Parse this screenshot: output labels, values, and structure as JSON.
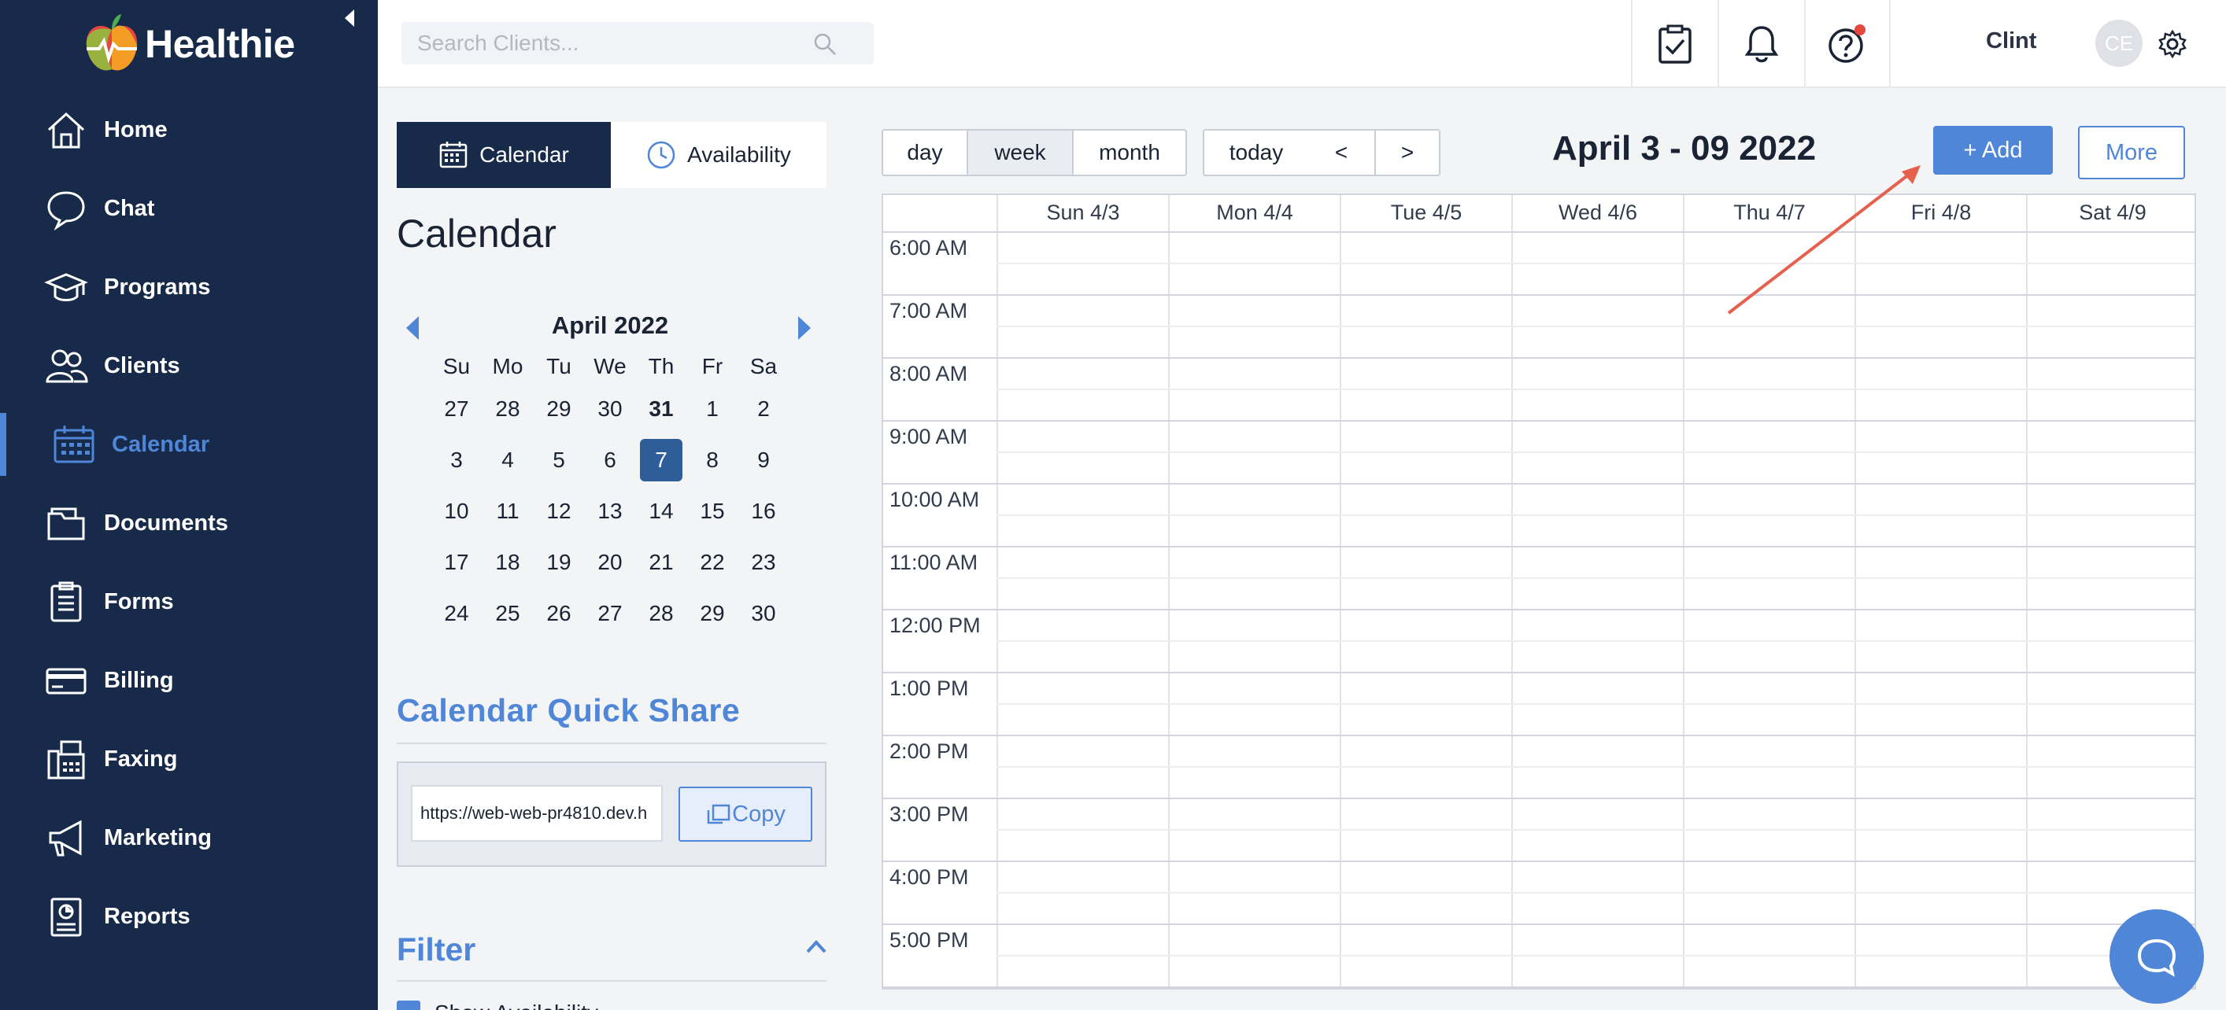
{
  "app": {
    "name": "Healthie"
  },
  "sidebar": {
    "items": [
      {
        "label": "Home",
        "icon": "home-icon"
      },
      {
        "label": "Chat",
        "icon": "chat-icon"
      },
      {
        "label": "Programs",
        "icon": "graduation-cap-icon"
      },
      {
        "label": "Clients",
        "icon": "users-icon"
      },
      {
        "label": "Calendar",
        "icon": "calendar-icon",
        "active": true
      },
      {
        "label": "Documents",
        "icon": "folder-icon"
      },
      {
        "label": "Forms",
        "icon": "clipboard-icon"
      },
      {
        "label": "Billing",
        "icon": "credit-card-icon"
      },
      {
        "label": "Faxing",
        "icon": "fax-icon"
      },
      {
        "label": "Marketing",
        "icon": "megaphone-icon"
      },
      {
        "label": "Reports",
        "icon": "report-icon"
      }
    ]
  },
  "topbar": {
    "search_placeholder": "Search Clients...",
    "user_name": "Clint",
    "avatar_initials": "CE"
  },
  "tabs": {
    "calendar": "Calendar",
    "availability": "Availability"
  },
  "panel_title": "Calendar",
  "mini_calendar": {
    "month_label": "April 2022",
    "weekdays": [
      "Su",
      "Mo",
      "Tu",
      "We",
      "Th",
      "Fr",
      "Sa"
    ],
    "weeks": [
      [
        "27",
        "28",
        "29",
        "30",
        "31",
        "1",
        "2"
      ],
      [
        "3",
        "4",
        "5",
        "6",
        "7",
        "8",
        "9"
      ],
      [
        "10",
        "11",
        "12",
        "13",
        "14",
        "15",
        "16"
      ],
      [
        "17",
        "18",
        "19",
        "20",
        "21",
        "22",
        "23"
      ],
      [
        "24",
        "25",
        "26",
        "27",
        "28",
        "29",
        "30"
      ]
    ],
    "selected": "7"
  },
  "quick_share": {
    "title": "Calendar Quick Share",
    "url": "https://web-web-pr4810.dev.h",
    "copy_label": "Copy"
  },
  "filter": {
    "title": "Filter",
    "checkbox_label": "Show Availability"
  },
  "view_buttons": {
    "day": "day",
    "week": "week",
    "month": "month",
    "today": "today",
    "prev": "<",
    "next": ">"
  },
  "range_title": "April 3 - 09 2022",
  "actions": {
    "add": "+ Add",
    "more": "More"
  },
  "week": {
    "days": [
      "Sun 4/3",
      "Mon 4/4",
      "Tue 4/5",
      "Wed 4/6",
      "Thu 4/7",
      "Fri 4/8",
      "Sat 4/9"
    ],
    "times": [
      "6:00 AM",
      "7:00 AM",
      "8:00 AM",
      "9:00 AM",
      "10:00 AM",
      "11:00 AM",
      "12:00 PM",
      "1:00 PM",
      "2:00 PM",
      "3:00 PM",
      "4:00 PM",
      "5:00 PM"
    ]
  },
  "colors": {
    "sidebar": "#172a4a",
    "accent": "#4f86d8",
    "selected_day": "#2f5d9a",
    "arrow": "#e5614e"
  }
}
